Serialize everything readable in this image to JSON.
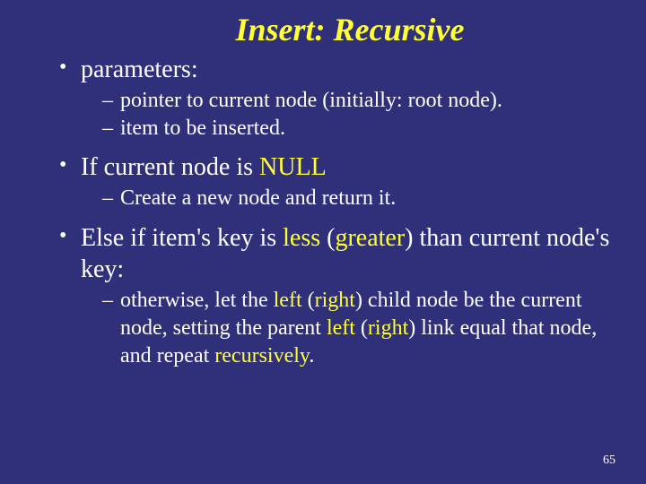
{
  "title": "Insert: Recursive",
  "bullets": {
    "b1": {
      "label": "parameters:"
    },
    "b1s1": "pointer to current node (initially: root node).",
    "b1s2": "item to be inserted.",
    "b2": {
      "p1": "If current node is ",
      "hl": "NULL"
    },
    "b2s1": "Create a new node and return it.",
    "b3": {
      "p1": "Else if item's key is ",
      "hl1": "less",
      "p2": " (",
      "hl2": "greater",
      "p3": ") than current node's key:"
    },
    "b3s1": {
      "p1": "otherwise, let the ",
      "hl1": "left",
      "p2": " (",
      "hl2": "right",
      "p3": ") child node be the current node, setting the parent ",
      "hl3": "left",
      "p4": " (",
      "hl4": "right",
      "p5": ") link equal that node, and repeat ",
      "hl5": "recursively",
      "p6": "."
    }
  },
  "page": "65"
}
